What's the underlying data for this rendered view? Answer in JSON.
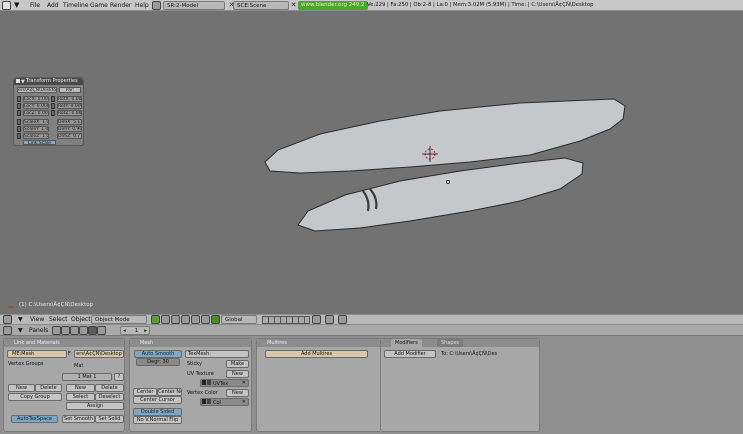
{
  "topbar": {
    "menus": [
      "File",
      "Add",
      "Timeline",
      "Game",
      "Render",
      "Help"
    ],
    "screen_field": "SR:2-Model",
    "scene_field": "SCE:Scene",
    "website": "www.blender.org 249.2",
    "stats": "Ve:229 | Fa:250 | Ob:2-8 | La:0  | Mem:3.02M (5.93M)  | Time:  | C:\\Users\\Ä¢ÇÑ\\Desktop"
  },
  "viewport": {
    "status_label": "(1) C:\\Users\\Ä¢ÇÑ\\Desktop"
  },
  "transform_panel": {
    "title": "Transform Properties",
    "name_field": "ers\\Ä¢ÇÑ\\Desktop",
    "par_field": "Par:",
    "loc": [
      "LocX: 0.000",
      "LocY: 0.000",
      "LocZ: 0.000"
    ],
    "rot": [
      "RotX: 0.000",
      "RotY: 0.000",
      "RotZ: 0.000"
    ],
    "scale": [
      "ScaleX: 1.000",
      "ScaleY: 1.000",
      "ScaleZ: 1.000"
    ],
    "dim": [
      "DimX: 5.135",
      "DimY: 0.900",
      "DimZ: 0.778"
    ],
    "link_scale": "Link Scale"
  },
  "viewheader": {
    "menus": [
      "View",
      "Select",
      "Object"
    ],
    "mode": "Object Mode",
    "orientation": "Global"
  },
  "panelheader": {
    "label": "Panels",
    "frame": "1"
  },
  "link_materials": {
    "title": "Link and Materials",
    "me_field": "ME:Mesh",
    "f_label": "F",
    "ob_field": "ers\\Ä¢ÇÑ\\Desktop",
    "vertex_groups": "Vertex Groups",
    "mat_label": "Mat",
    "mat_count": "1 Mat 1",
    "mat_q": "?",
    "new_left": "New",
    "delete_left": "Delete",
    "copy_group": "Copy Group",
    "new_right": "New",
    "delete_right": "Delete",
    "select": "Select",
    "deselect": "Deselect",
    "assign": "Assign",
    "autotexspace": "AutoTexSpace",
    "set_smooth": "Set Smooth",
    "set_solid": "Set Solid"
  },
  "mesh": {
    "title": "Mesh",
    "auto_smooth": "Auto Smooth",
    "degr": "Degr: 30",
    "texmesh": "TexMesh:",
    "sticky": "Sticky",
    "make": "Make",
    "uv_texture": "UV Texture",
    "new_uv": "New",
    "uvtex": "UVTex",
    "vertex_color": "Vertex Color",
    "new_vc": "New",
    "col": "Col",
    "center": "Center",
    "center_new": "Center New",
    "center_cursor": "Center Cursor",
    "double_sided": "Double Sided",
    "no_v_normal_flip": "No V.Normal Flip"
  },
  "multires": {
    "title": "Multires",
    "add_multires": "Add Multires"
  },
  "modifiers": {
    "tab_modifiers": "Modifiers",
    "tab_shapes": "Shapes",
    "add_modifier": "Add Modifier",
    "to_label": "To: C:\\Users\\Ä¢ÇÑ\\Des"
  },
  "colors": {
    "viewport_bg": "#727272",
    "object_fill": "#c4c8ca",
    "accent_green": "#4aa82a",
    "button_blue": "#7fa7c2"
  }
}
